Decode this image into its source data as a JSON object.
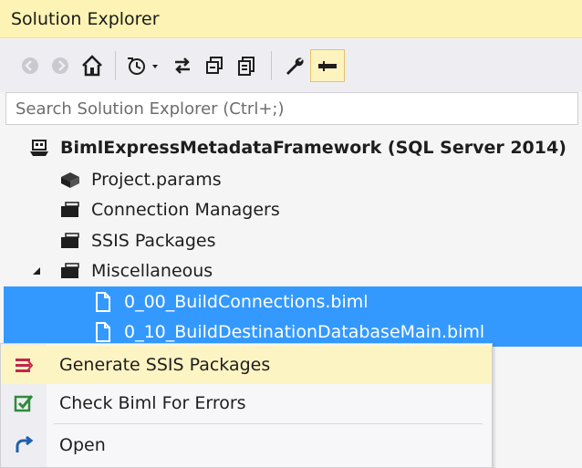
{
  "panel": {
    "title": "Solution Explorer"
  },
  "toolbar": {
    "buttons": [
      {
        "name": "back",
        "icon": "back-arrow-icon"
      },
      {
        "name": "forward",
        "icon": "forward-arrow-icon"
      },
      {
        "name": "home",
        "icon": "home-icon"
      },
      {
        "name": "pending-changes",
        "icon": "history-clock-icon"
      },
      {
        "name": "sync",
        "icon": "sync-arrows-icon"
      },
      {
        "name": "collapse-all",
        "icon": "collapse-all-icon"
      },
      {
        "name": "show-all-files",
        "icon": "show-all-files-icon"
      },
      {
        "name": "properties",
        "icon": "wrench-icon"
      },
      {
        "name": "preview",
        "icon": "pin-icon"
      }
    ]
  },
  "search": {
    "placeholder": "Search Solution Explorer (Ctrl+;)"
  },
  "tree": {
    "root": "BimlExpressMetadataFramework (SQL Server 2014)",
    "items": [
      {
        "label": "Project.params"
      },
      {
        "label": "Connection Managers"
      },
      {
        "label": "SSIS Packages"
      },
      {
        "label": "Miscellaneous"
      },
      {
        "label": "0_00_BuildConnections.biml"
      },
      {
        "label": "0_10_BuildDestinationDatabaseMain.biml"
      }
    ]
  },
  "context_menu": {
    "items": [
      {
        "label": "Generate SSIS Packages"
      },
      {
        "label": "Check Biml For Errors"
      },
      {
        "label": "Open"
      }
    ]
  },
  "colors": {
    "title_bg": "#fcf3b4",
    "selection": "#3399ff",
    "menu_hover": "#fdf4c4"
  }
}
